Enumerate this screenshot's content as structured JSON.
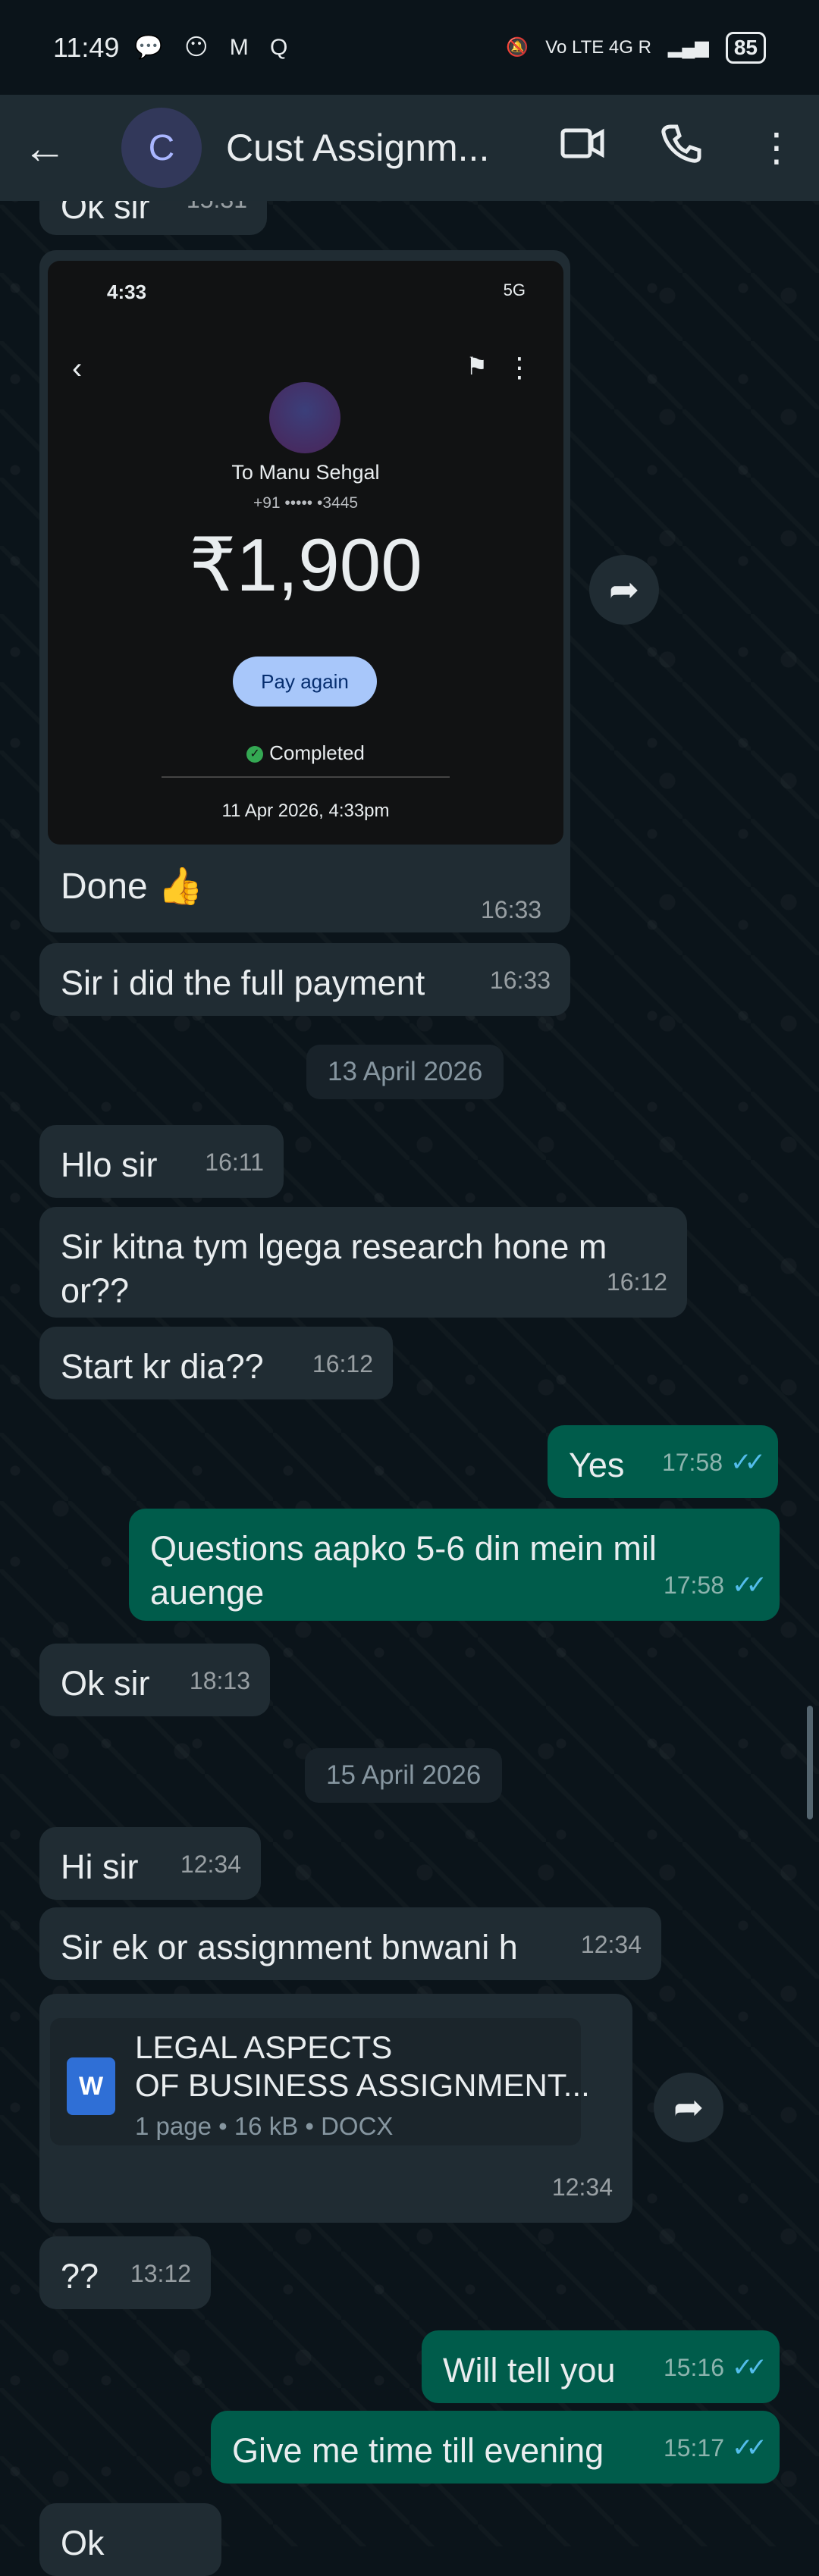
{
  "status_bar": {
    "time": "11:49",
    "icons": "💬 😶 M Q",
    "net": "Vo LTE 4G R",
    "battery": "85"
  },
  "app_bar": {
    "back_icon": "arrow-left-icon",
    "avatar_letter": "C",
    "title": "Cust Assignm...",
    "video_icon": "video-icon",
    "call_icon": "phone-icon",
    "menu_icon": "more-vertical-icon"
  },
  "messages": {
    "partial_top": {
      "text": "Ok sir",
      "time": "15:31"
    },
    "image": {
      "status_time": "4:33",
      "status_right": "5G",
      "to": "To Manu Sehgal",
      "phone": "+91 ••••• •3445",
      "amount": "₹1,900",
      "pay_again": "Pay again",
      "completed": "Completed",
      "date": "11 Apr 2026, 4:33pm"
    },
    "done": {
      "text": "Done 👍",
      "time": "16:33"
    },
    "full_payment": {
      "text": "Sir i did the full payment",
      "time": "16:33"
    },
    "date1": "13 April 2026",
    "hlo": {
      "text": "Hlo sir",
      "time": "16:11"
    },
    "kitna": {
      "text": "Sir kitna tym lgega research hone m or??",
      "time": "16:12"
    },
    "start": {
      "text": "Start kr dia??",
      "time": "16:12"
    },
    "yes": {
      "text": "Yes",
      "time": "17:58"
    },
    "questions": {
      "text": "Questions aapko 5-6 din mein mil auenge",
      "time": "17:58"
    },
    "ok_sir": {
      "text": "Ok sir",
      "time": "18:13"
    },
    "date2": "15 April 2026",
    "hi_sir": {
      "text": "Hi sir",
      "time": "12:34"
    },
    "ek_or": {
      "text": "Sir ek or assignment bnwani h",
      "time": "12:34"
    },
    "doc": {
      "title_line1": "LEGAL ASPECTS",
      "title_line2": "OF BUSINESS ASSIGNMENT...",
      "meta": "1 page • 16 kB • DOCX",
      "time": "12:34",
      "icon_letter": "W"
    },
    "qq": {
      "text": "??",
      "time": "13:12"
    },
    "will_tell": {
      "text": "Will tell you",
      "time": "15:16"
    },
    "give_time": {
      "text": "Give me time till evening",
      "time": "15:17"
    },
    "partial_bottom": {
      "text": "Ok"
    }
  },
  "colors": {
    "incoming": "#202c33",
    "outgoing": "#005c4b",
    "tick_read": "#53bdeb",
    "background": "#0b141a"
  }
}
